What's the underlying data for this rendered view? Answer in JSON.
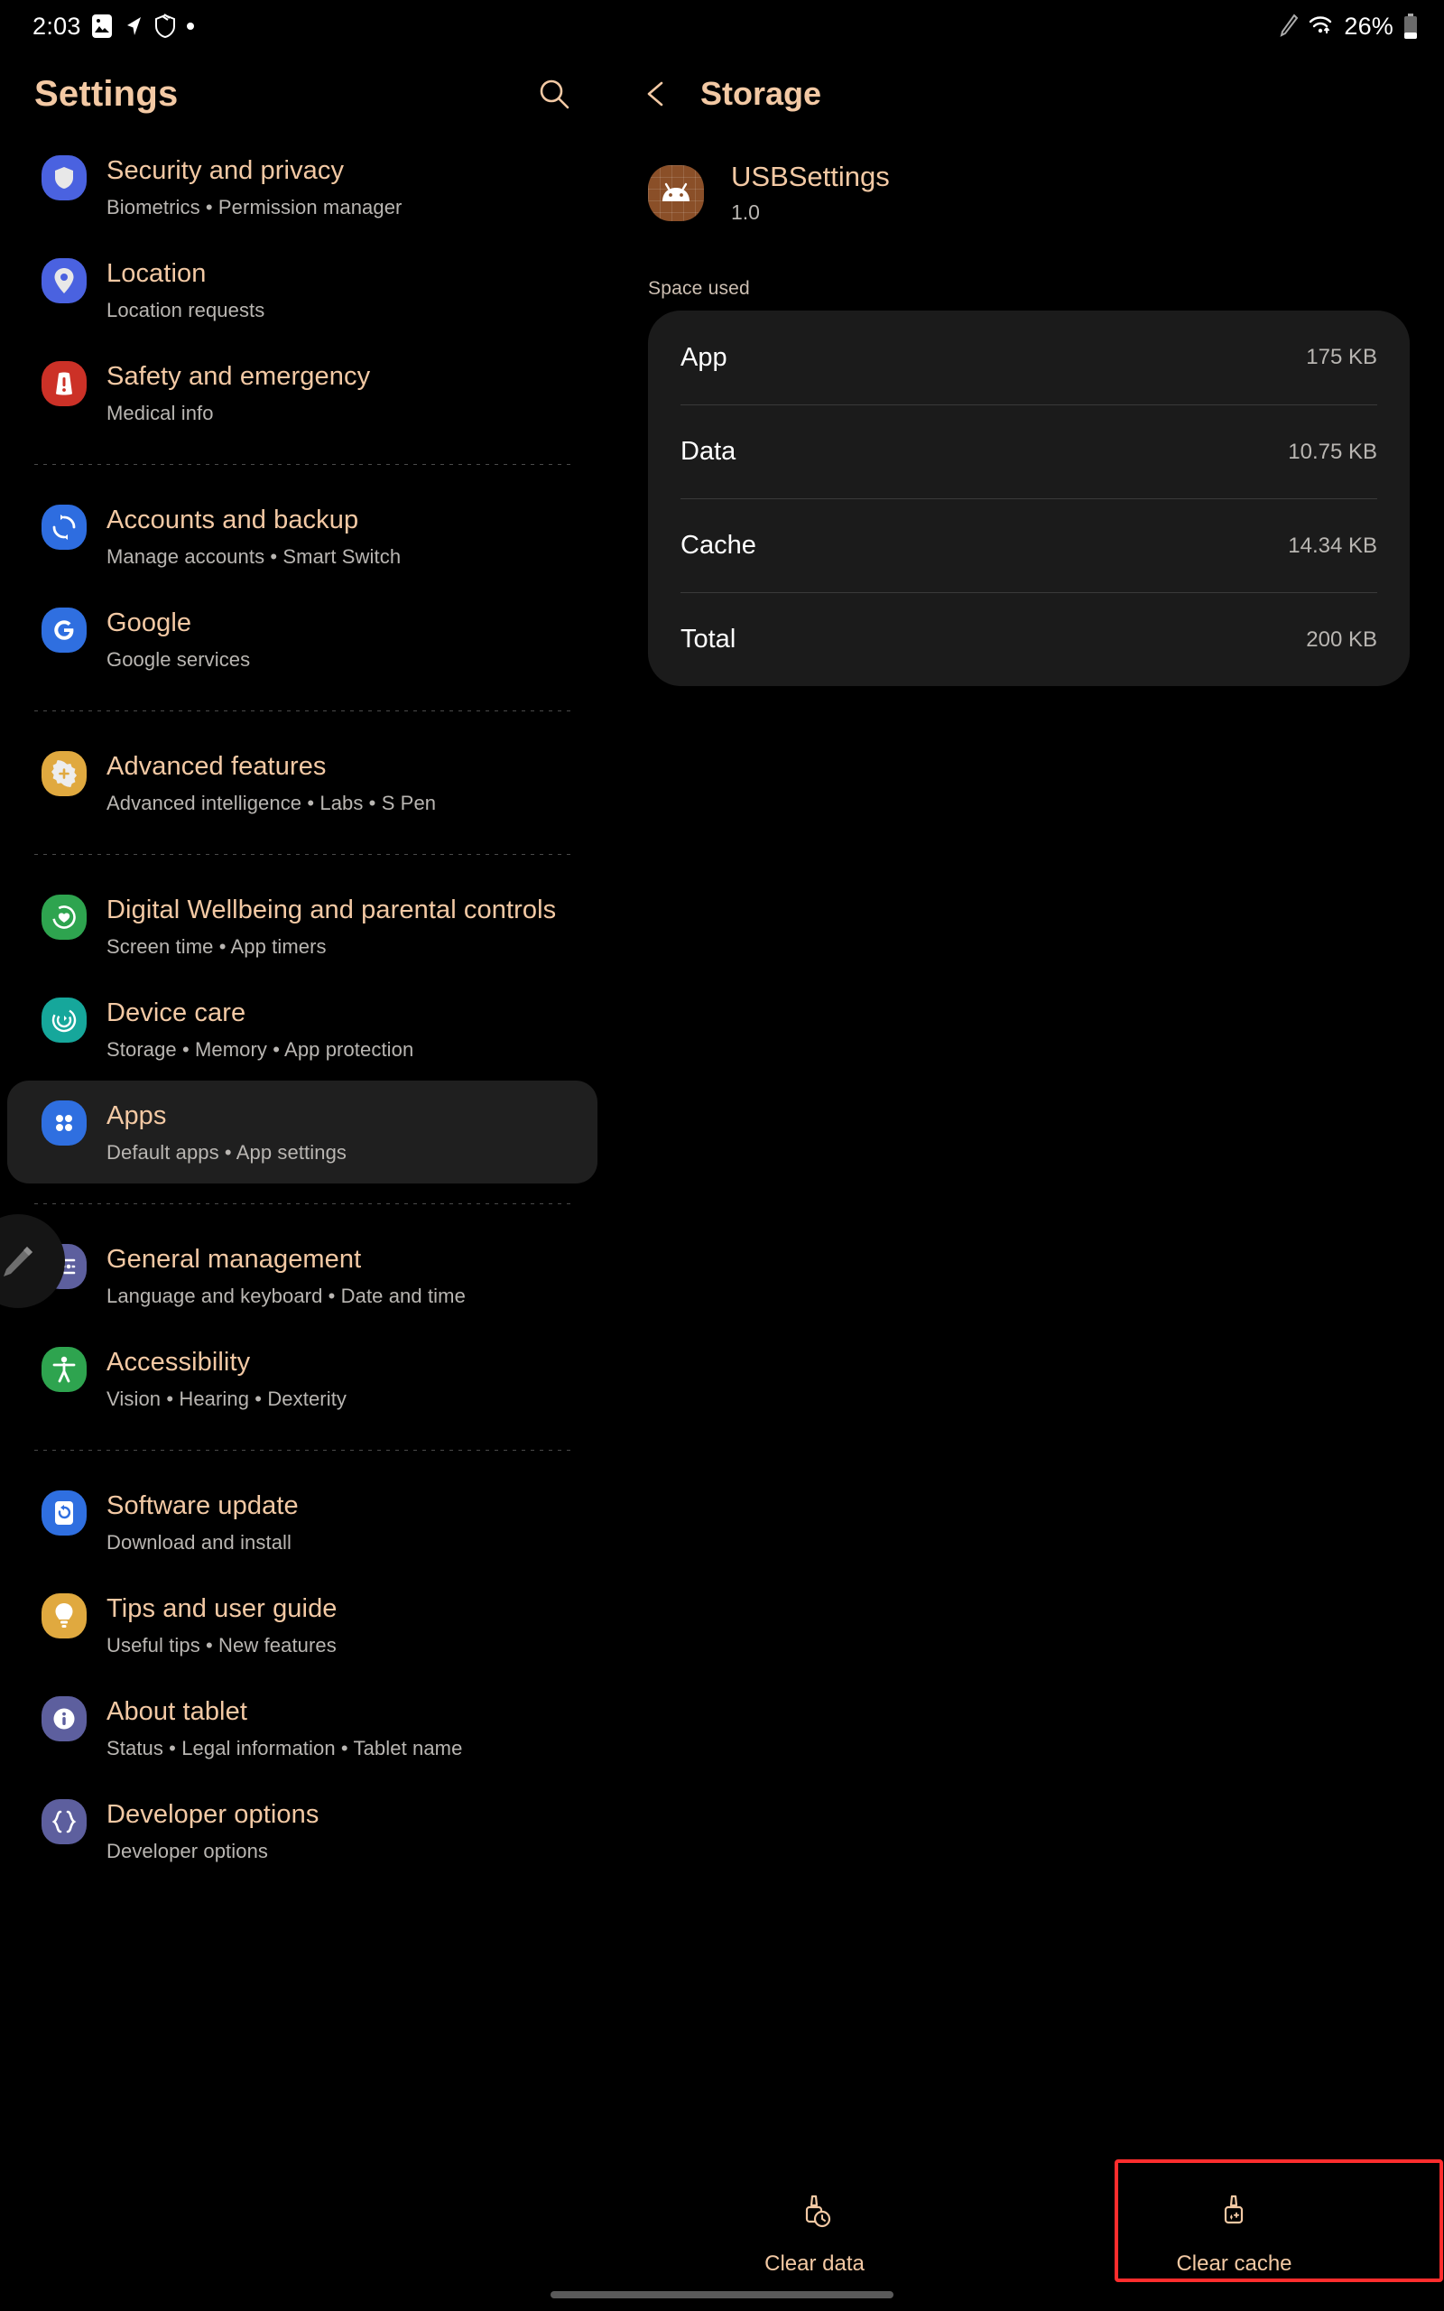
{
  "status_bar": {
    "time": "2:03",
    "battery_percent": "26%",
    "left_icons": [
      "image-icon",
      "location-arrow-icon",
      "shield-icon",
      "dot-icon"
    ],
    "right_icons": [
      "spen-icon",
      "wifi-icon",
      "battery-icon"
    ]
  },
  "sidebar": {
    "title": "Settings",
    "search_icon": "search-icon",
    "groups": [
      {
        "items": [
          {
            "title": "Security and privacy",
            "subtitle": "Biometrics  •  Permission manager",
            "icon": "shield-icon",
            "color": "#4a62e0",
            "selected": false
          },
          {
            "title": "Location",
            "subtitle": "Location requests",
            "icon": "location-pin-icon",
            "color": "#4a62e0",
            "selected": false
          },
          {
            "title": "Safety and emergency",
            "subtitle": "Medical info",
            "icon": "emergency-icon",
            "color": "#cc3127",
            "selected": false
          }
        ]
      },
      {
        "items": [
          {
            "title": "Accounts and backup",
            "subtitle": "Manage accounts  •  Smart Switch",
            "icon": "sync-icon",
            "color": "#2e6de0",
            "selected": false
          },
          {
            "title": "Google",
            "subtitle": "Google services",
            "icon": "google-g-icon",
            "color": "#2f6fe0",
            "selected": false
          }
        ]
      },
      {
        "items": [
          {
            "title": "Advanced features",
            "subtitle": "Advanced intelligence  •  Labs  •  S Pen",
            "icon": "gear-plus-icon",
            "color": "#e0a93f",
            "selected": false
          }
        ]
      },
      {
        "items": [
          {
            "title": "Digital Wellbeing and parental controls",
            "subtitle": "Screen time  •  App timers",
            "icon": "wellbeing-icon",
            "color": "#2ea44f",
            "selected": false
          },
          {
            "title": "Device care",
            "subtitle": "Storage  •  Memory  •  App protection",
            "icon": "device-care-icon",
            "color": "#16a79b",
            "selected": false
          },
          {
            "title": "Apps",
            "subtitle": "Default apps  •  App settings",
            "icon": "apps-grid-icon",
            "color": "#2f6fe0",
            "selected": true
          }
        ]
      },
      {
        "items": [
          {
            "title": "General management",
            "subtitle": "Language and keyboard  •  Date and time",
            "icon": "sliders-icon",
            "color": "#5d5f9e",
            "selected": false
          },
          {
            "title": "Accessibility",
            "subtitle": "Vision  •  Hearing  •  Dexterity",
            "icon": "accessibility-icon",
            "color": "#2ea44f",
            "selected": false
          }
        ]
      },
      {
        "items": [
          {
            "title": "Software update",
            "subtitle": "Download and install",
            "icon": "software-update-icon",
            "color": "#2f6fe0",
            "selected": false
          },
          {
            "title": "Tips and user guide",
            "subtitle": "Useful tips  •  New features",
            "icon": "lightbulb-icon",
            "color": "#e0a93f",
            "selected": false
          },
          {
            "title": "About tablet",
            "subtitle": "Status  •  Legal information  •  Tablet name",
            "icon": "info-icon",
            "color": "#5d5f9e",
            "selected": false
          },
          {
            "title": "Developer options",
            "subtitle": "Developer options",
            "icon": "braces-icon",
            "color": "#5d5f9e",
            "selected": false
          }
        ]
      }
    ],
    "floating_spen_handle": "spen-handle-icon"
  },
  "detail": {
    "back_icon": "chevron-left-icon",
    "title": "Storage",
    "app": {
      "name": "USBSettings",
      "version": "1.0",
      "icon": "android-robot-icon"
    },
    "space_used_label": "Space used",
    "rows": [
      {
        "label": "App",
        "value": "175 KB"
      },
      {
        "label": "Data",
        "value": "10.75 KB"
      },
      {
        "label": "Cache",
        "value": "14.34 KB"
      },
      {
        "label": "Total",
        "value": "200 KB"
      }
    ],
    "actions": [
      {
        "label": "Clear data",
        "icon": "clear-data-brush-icon",
        "highlighted": false
      },
      {
        "label": "Clear cache",
        "icon": "clear-cache-brush-icon",
        "highlighted": true
      }
    ]
  },
  "colors": {
    "accent_text": "#f3c9a4",
    "highlight_box": "#ff2d2d",
    "card_bg": "#1b1b1b",
    "selected_bg": "#1f1f1f"
  }
}
